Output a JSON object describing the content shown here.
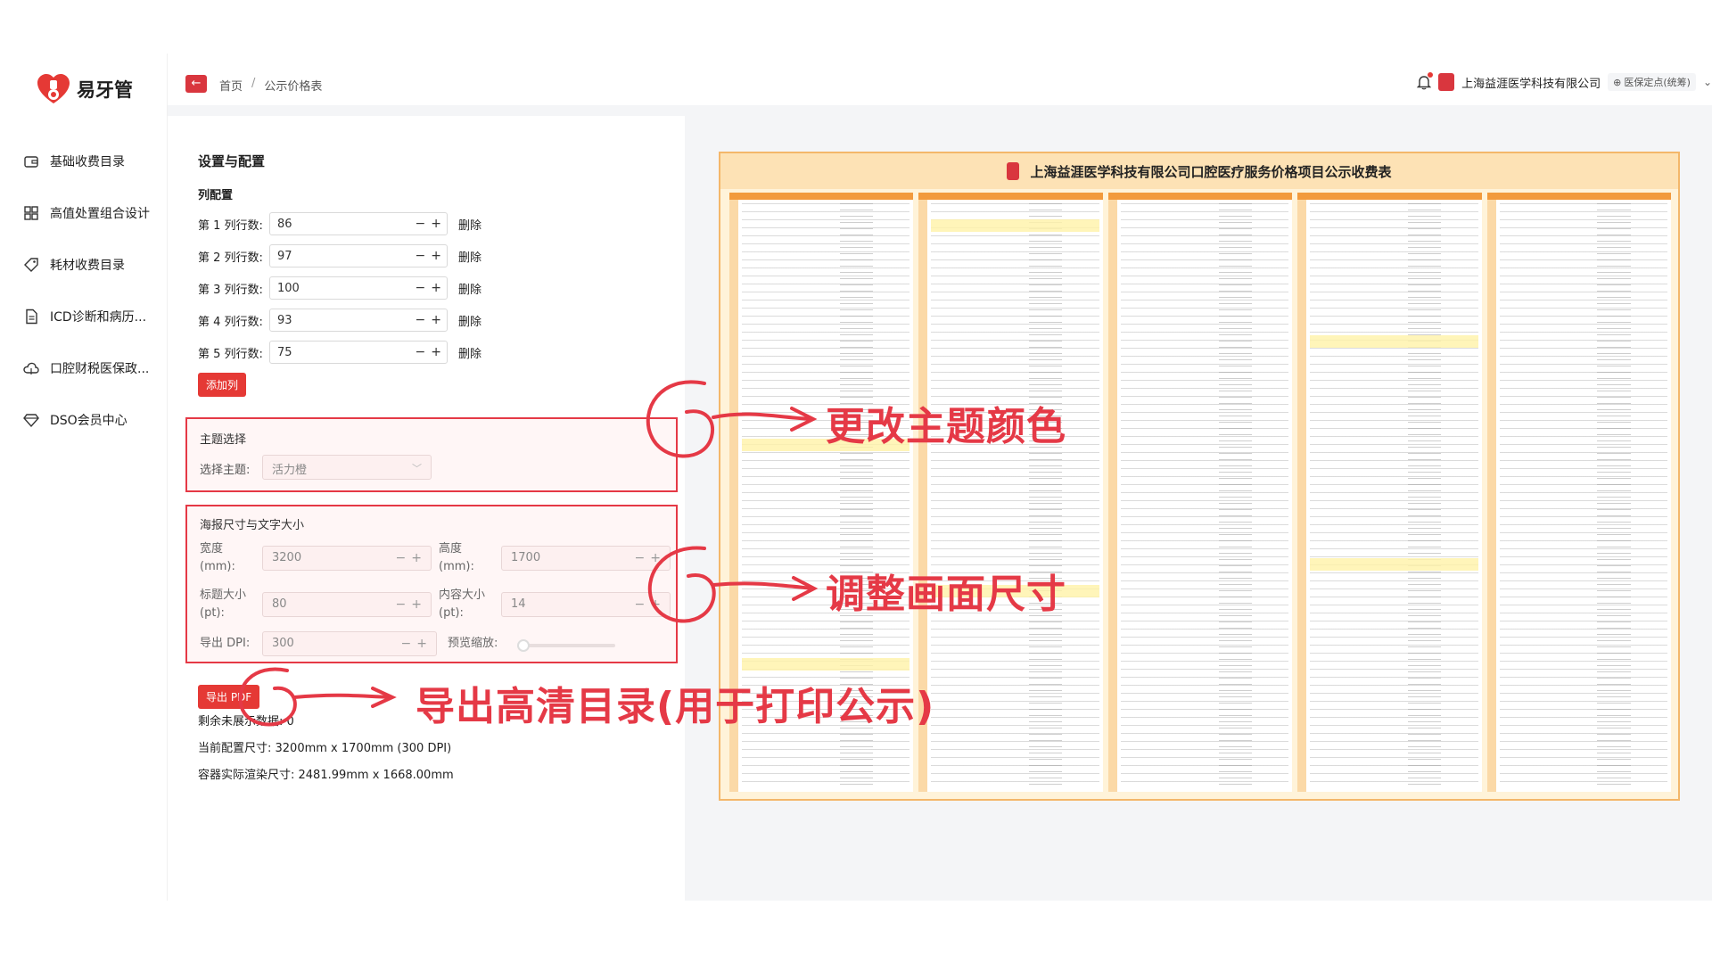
{
  "brand": {
    "name": "易牙管",
    "accent": "#e53935"
  },
  "sidebar": {
    "items": [
      {
        "label": "基础收费目录",
        "icon": "wallet-icon"
      },
      {
        "label": "高值处置组合设计",
        "icon": "grid-icon"
      },
      {
        "label": "耗材收费目录",
        "icon": "tag-icon"
      },
      {
        "label": "ICD诊断和病历...",
        "icon": "document-icon"
      },
      {
        "label": "口腔财税医保政...",
        "icon": "cloud-icon"
      },
      {
        "label": "DSO会员中心",
        "icon": "diamond-icon"
      }
    ]
  },
  "header": {
    "back_icon": "←",
    "breadcrumb": {
      "home": "首页",
      "separator": "/",
      "current": "公示价格表"
    },
    "company": "上海益涯医学科技有限公司",
    "tag": "医保定点(统筹)",
    "tag_icon": "⊕",
    "dropdown_icon": "⌄"
  },
  "settings": {
    "title": "设置与配置",
    "columns_title": "列配置",
    "columns": [
      {
        "label": "第 1 列行数:",
        "value": "86"
      },
      {
        "label": "第 2 列行数:",
        "value": "97"
      },
      {
        "label": "第 3 列行数:",
        "value": "100"
      },
      {
        "label": "第 4 列行数:",
        "value": "93"
      },
      {
        "label": "第 5 列行数:",
        "value": "75"
      }
    ],
    "delete_label": "删除",
    "add_column_label": "添加列",
    "stepper_minus": "−",
    "stepper_plus": "+",
    "theme": {
      "title": "主题选择",
      "label": "选择主题:",
      "value": "活力橙"
    },
    "size": {
      "title": "海报尺寸与文字大小",
      "width_label": "宽度 (mm):",
      "width_value": "3200",
      "height_label": "高度 (mm):",
      "height_value": "1700",
      "title_size_label": "标题大小 (pt):",
      "title_size_value": "80",
      "content_size_label": "内容大小 (pt):",
      "content_size_value": "14",
      "dpi_label": "导出 DPI:",
      "dpi_value": "300",
      "zoom_label": "预览缩放:"
    },
    "export_label": "导出 PDF",
    "remaining_label": "剩余未展示数据: 0",
    "current_size": "当前配置尺寸: 3200mm x 1700mm (300 DPI)",
    "render_size": "容器实际渲染尺寸: 2481.99mm x 1668.00mm"
  },
  "annotations": {
    "theme": "更改主题颜色",
    "size": "调整画面尺寸",
    "export": "导出高清目录(用于打印公示)",
    "color": "#e53946"
  },
  "poster": {
    "title": "上海益涯医学科技有限公司口腔医疗服务价格项目公示收费表",
    "column_count": 5,
    "theme_color": "#f29a3c"
  }
}
